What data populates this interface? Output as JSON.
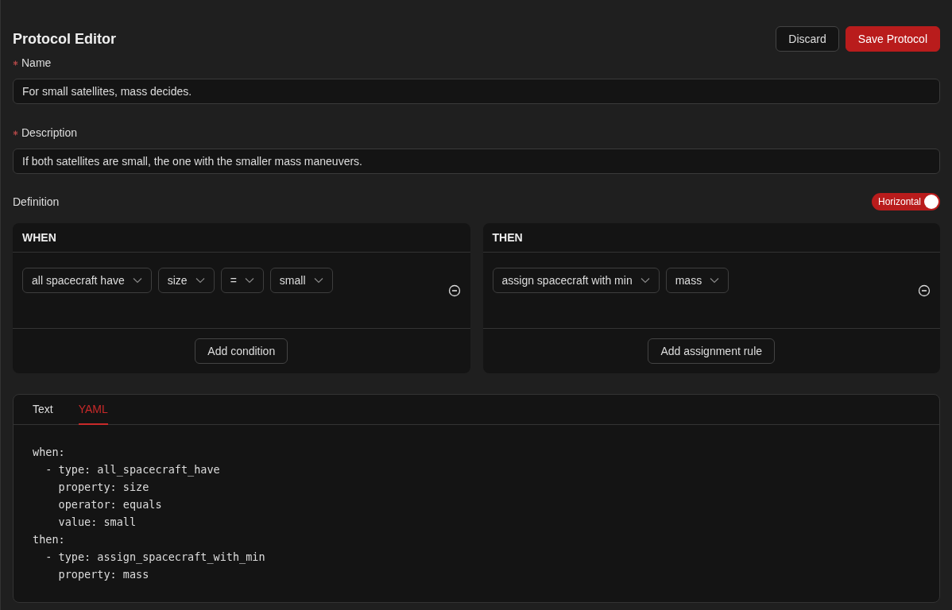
{
  "header": {
    "title": "Protocol Editor",
    "buttons": [
      {
        "label": "Discard",
        "kind": "secondary"
      },
      {
        "label": "Save Protocol",
        "kind": "primary"
      }
    ]
  },
  "fields": [
    {
      "label": "Name",
      "required": true,
      "value": "For small satellites, mass decides."
    },
    {
      "label": "Description",
      "required": true,
      "value": "If both satellites are small, the one with the smaller mass maneuvers."
    }
  ],
  "definition": {
    "label": "Definition",
    "toggle": {
      "label": "Horizontal",
      "on": true
    }
  },
  "panels": [
    {
      "title": "WHEN",
      "rows": [
        {
          "selects": [
            "all spacecraft have",
            "size",
            "=",
            "small"
          ]
        }
      ],
      "add_button": "Add condition"
    },
    {
      "title": "THEN",
      "rows": [
        {
          "selects": [
            "assign spacecraft with min",
            "mass"
          ]
        }
      ],
      "add_button": "Add assignment rule"
    }
  ],
  "output": {
    "tabs": [
      {
        "label": "Text",
        "selected": false
      },
      {
        "label": "YAML",
        "selected": true
      }
    ],
    "code_lines": [
      "when:",
      "  - type: all_spacecraft_have",
      "    property: size",
      "    operator: equals",
      "    value: small",
      "then:",
      "  - type: assign_spacecraft_with_min",
      "    property: mass"
    ]
  }
}
